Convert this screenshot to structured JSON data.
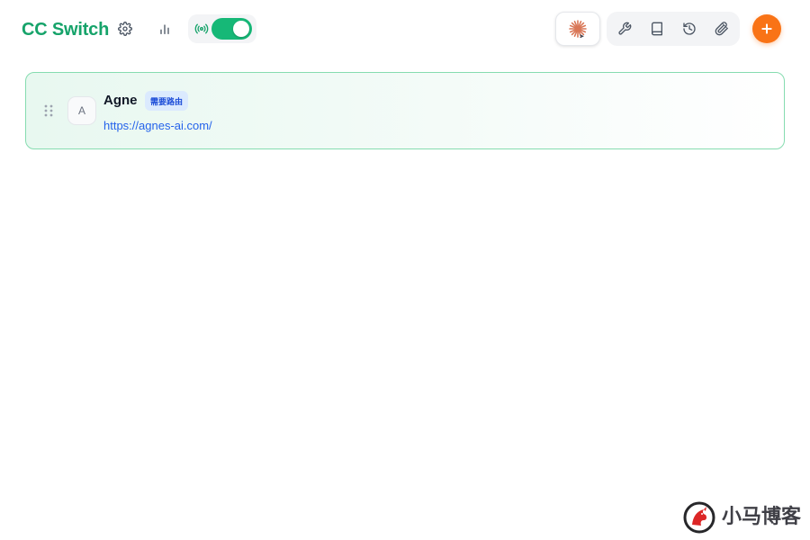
{
  "header": {
    "title": "CC Switch",
    "left_icons": [
      "gear-icon",
      "bar-chart-icon"
    ],
    "proxy": {
      "icon": "broadcast-icon",
      "enabled": true
    },
    "current_app_icon": "claude-icon",
    "tools": [
      "wrench-icon",
      "book-icon",
      "history-icon",
      "paperclip-icon"
    ],
    "add_icon": "plus-icon"
  },
  "providers": [
    {
      "avatar_letter": "A",
      "name": "Agne",
      "badge": "需要路由",
      "url": "https://agnes-ai.com/",
      "active": true
    }
  ],
  "watermark": {
    "text": "小马博客"
  },
  "colors": {
    "brand_green": "#16a36a",
    "toggle_on": "#16b877",
    "add_orange": "#f97316",
    "card_border": "#86dcb0",
    "badge_bg": "#dbeafe",
    "badge_text": "#1d4ed8",
    "link": "#2563eb",
    "claude_orange": "#d97757"
  }
}
